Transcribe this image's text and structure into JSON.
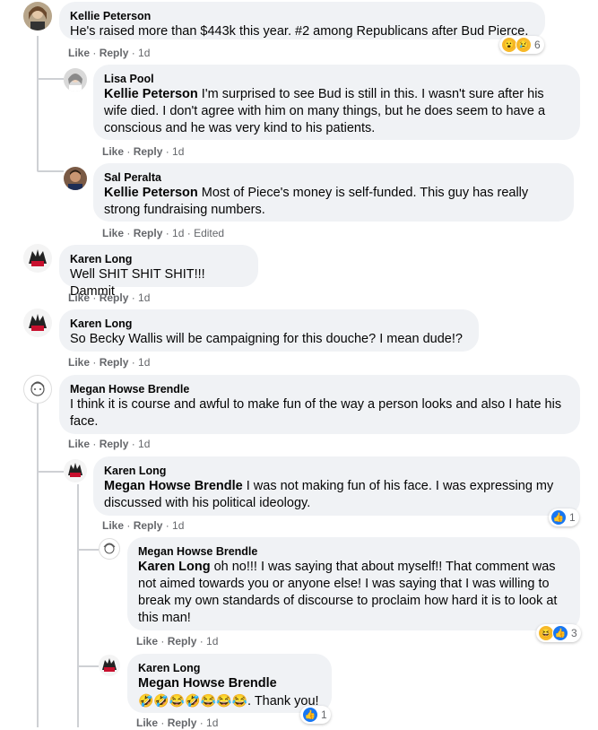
{
  "actions": {
    "like": "Like",
    "reply": "Reply",
    "sep": " · "
  },
  "comments": [
    {
      "author": "Kellie Peterson",
      "text": "He's raised more than $443k this year. #2 among Republicans after Bud Pierce.",
      "time": "1d",
      "reaction_count": "6",
      "reaction_icons": [
        "wow-reaction-icon",
        "sad-reaction-icon"
      ]
    },
    {
      "author": "Lisa Pool",
      "mention": "Kellie Peterson",
      "text": " I'm surprised to see Bud is still in this. I wasn't sure after his wife died. I don't agree with him on many things, but he does seem to have a conscious and he was very kind to his patients.",
      "time": "1d"
    },
    {
      "author": "Sal Peralta",
      "mention": "Kellie Peterson",
      "text": " Most of Piece's money is self-funded. This guy has really strong fundraising numbers.",
      "time": "1d",
      "edited": "Edited"
    },
    {
      "author": "Karen Long",
      "text": "Well SHIT SHIT SHIT!!! Dammit",
      "time": "1d"
    },
    {
      "author": "Karen Long",
      "text": "So Becky Wallis will be campaigning for this douche? I mean dude!?",
      "time": "1d"
    },
    {
      "author": "Megan Howse Brendle",
      "text": "I think it is course and awful to make fun of the way a person looks and also I hate his face.",
      "time": "1d"
    },
    {
      "author": "Karen Long",
      "mention": "Megan Howse Brendle",
      "text": " I was not making fun of his face. I was expressing my discussed with his political ideology.",
      "time": "1d",
      "reaction_count": "1",
      "reaction_icons": [
        "like-reaction-icon"
      ]
    },
    {
      "author": "Megan Howse Brendle",
      "mention": "Karen Long",
      "text": " oh no!!! I was saying that about myself!! That comment was not aimed towards you or anyone else! I was saying that I was willing to break my own standards of discourse to proclaim how hard it is to look at this man!",
      "time": "1d",
      "reaction_count": "3",
      "reaction_icons": [
        "haha-reaction-icon",
        "like-reaction-icon"
      ]
    },
    {
      "author": "Karen Long",
      "mention": "Megan Howse Brendle",
      "emojis": "🤣🤣😂🤣😂😂😂",
      "text": ". Thank you!",
      "time": "1d",
      "reaction_count": "1",
      "reaction_icons": [
        "like-reaction-icon"
      ]
    }
  ]
}
